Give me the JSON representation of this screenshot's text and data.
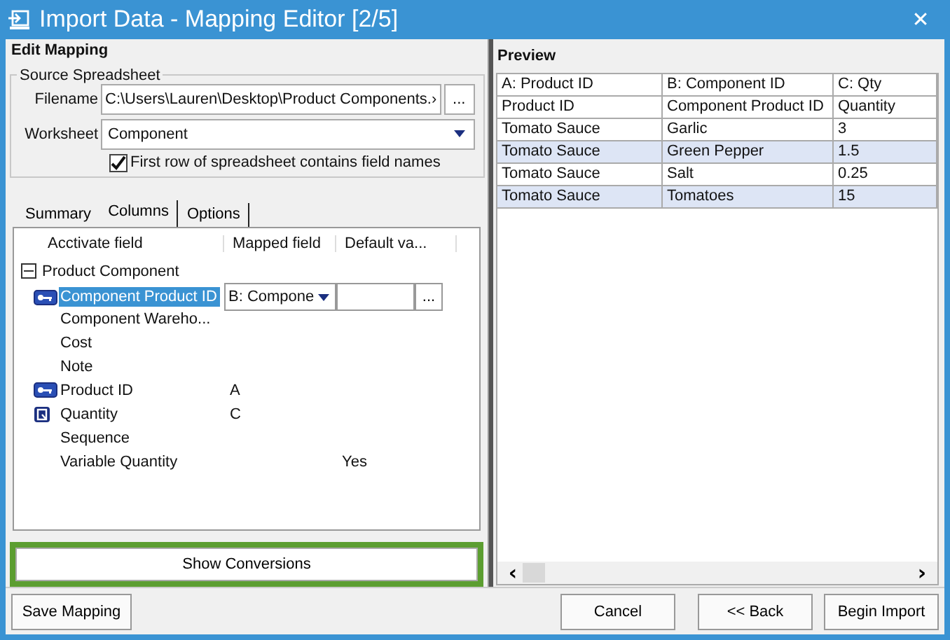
{
  "window": {
    "title": "Import Data - Mapping Editor [2/5]",
    "close": "✕"
  },
  "edit_mapping": {
    "title": "Edit Mapping",
    "source": {
      "legend": "Source Spreadsheet",
      "filename_label": "Filename",
      "filename": "C:\\Users\\Lauren\\Desktop\\Product Components.›",
      "browse": "...",
      "worksheet_label": "Worksheet",
      "worksheet": "Component",
      "first_row": {
        "label": "First row of spreadsheet contains field names",
        "checked": true
      }
    },
    "tabs": [
      {
        "label": "Summary",
        "selected": false
      },
      {
        "label": "Columns",
        "selected": true
      },
      {
        "label": "Options",
        "selected": false
      }
    ],
    "columns": [
      "Acctivate field",
      "Mapped field",
      "Default va..."
    ],
    "tree": [
      {
        "label": "Product Component",
        "expanded": true,
        "children": [
          {
            "label": "Component Product ID",
            "kind": "key",
            "selected": true,
            "editor": {
              "mapped": "B: Compone",
              "browse": "..."
            }
          },
          {
            "label": "Component Wareho...",
            "kind": "plain",
            "selected": false
          },
          {
            "label": "Cost",
            "kind": "plain",
            "selected": false
          },
          {
            "label": "Note",
            "kind": "plain",
            "selected": false
          },
          {
            "label": "Product ID",
            "kind": "key",
            "selected": false,
            "mapped": "A"
          },
          {
            "label": "Quantity",
            "kind": "required",
            "selected": false,
            "mapped": "C"
          },
          {
            "label": "Sequence",
            "kind": "plain",
            "selected": false
          },
          {
            "label": "Variable Quantity",
            "kind": "plain",
            "selected": false,
            "default": "Yes"
          }
        ]
      }
    ],
    "show_conversions": {
      "label": "Show Conversions",
      "highlighted": true
    }
  },
  "preview": {
    "title": "Preview",
    "columns": [
      "A: Product ID",
      "B: Component ID",
      "C: Qty"
    ],
    "rows": [
      {
        "cells": [
          "Product ID",
          "Component Product ID",
          "Quantity"
        ],
        "shaded": false
      },
      {
        "cells": [
          "Tomato Sauce",
          "Garlic",
          "3"
        ],
        "shaded": false
      },
      {
        "cells": [
          "Tomato Sauce",
          "Green Pepper",
          "1.5"
        ],
        "shaded": true
      },
      {
        "cells": [
          "Tomato Sauce",
          "Salt",
          "0.25"
        ],
        "shaded": false
      },
      {
        "cells": [
          "Tomato Sauce",
          "Tomatoes",
          "15"
        ],
        "shaded": true
      }
    ],
    "scroll_left": "‹",
    "scroll_right": "›"
  },
  "buttons": {
    "save": "Save Mapping",
    "cancel": "Cancel",
    "back": "<< Back",
    "begin": "Begin Import"
  }
}
